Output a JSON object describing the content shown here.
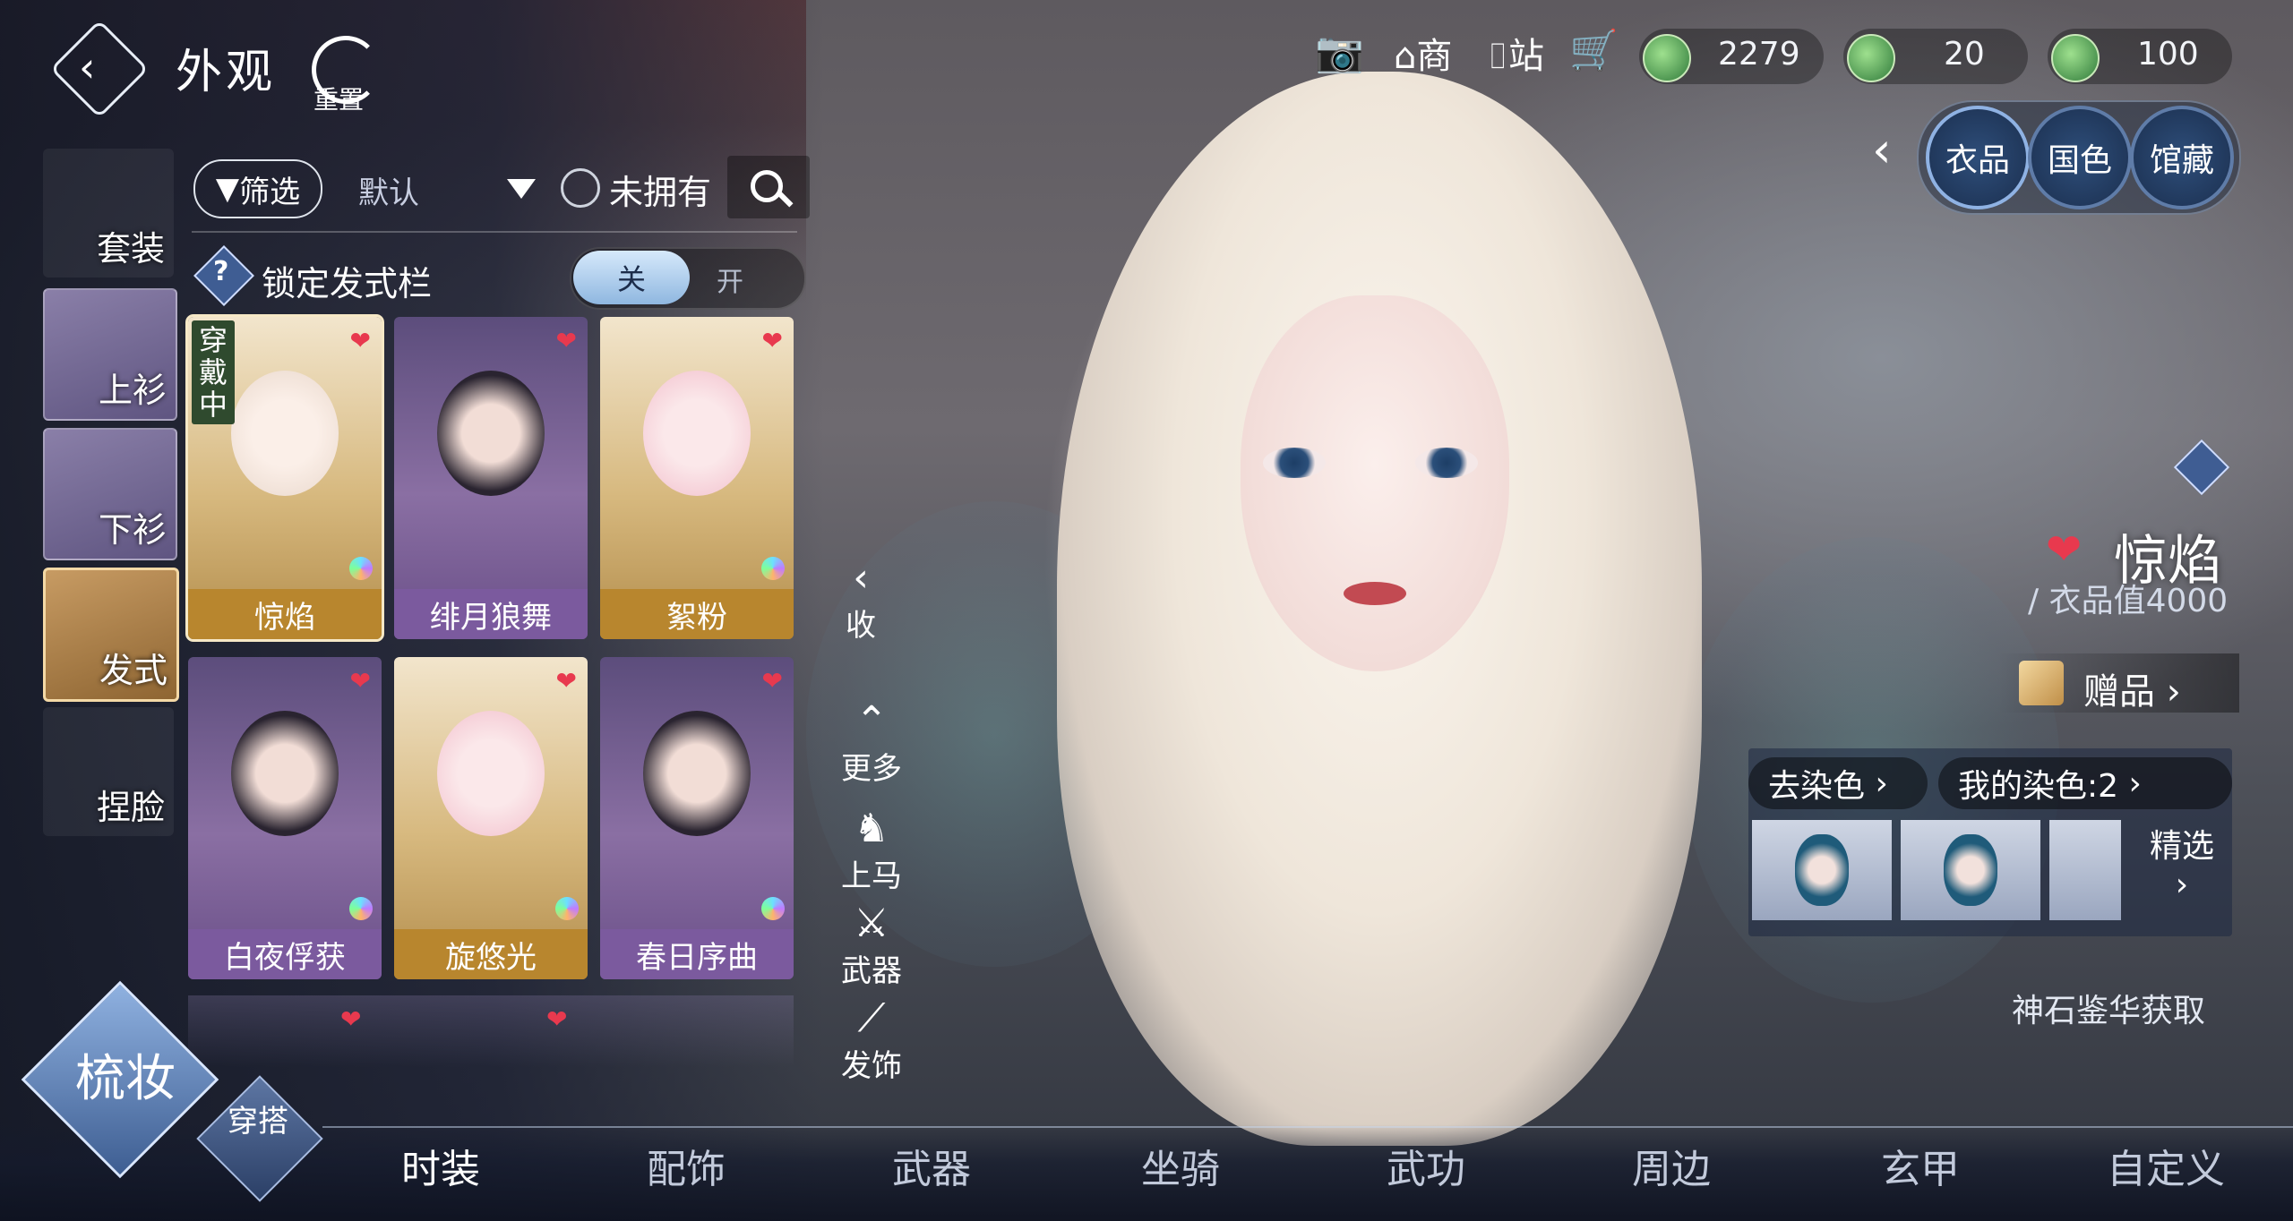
{
  "header": {
    "title": "外观",
    "reset_label": "重置"
  },
  "categories": [
    {
      "label": "套装"
    },
    {
      "label": "上衫"
    },
    {
      "label": "下衫"
    },
    {
      "label": "发式"
    },
    {
      "label": "捏脸"
    }
  ],
  "filter": {
    "filter_label": "筛选",
    "sort_label": "默认",
    "unowned_label": "未拥有"
  },
  "lock_row": {
    "label": "锁定发式栏",
    "help": "?",
    "toggle_on": "关",
    "toggle_off": "开"
  },
  "items": [
    {
      "name": "惊焰",
      "badge": "穿戴中",
      "style": "gold"
    },
    {
      "name": "绯月狼舞",
      "badge": "",
      "style": "purple"
    },
    {
      "name": "絮粉",
      "badge": "",
      "style": "gold"
    },
    {
      "name": "白夜俘获",
      "badge": "",
      "style": "purple"
    },
    {
      "name": "旋悠光",
      "badge": "",
      "style": "gold"
    },
    {
      "name": "春日序曲",
      "badge": "",
      "style": "purple"
    }
  ],
  "side_actions": [
    {
      "label": "收",
      "icon": "collapse-icon"
    },
    {
      "label": "更多",
      "icon": "more-icon"
    },
    {
      "label": "上马",
      "icon": "horse-icon"
    },
    {
      "label": "武器",
      "icon": "weapon-icon"
    },
    {
      "label": "发饰",
      "icon": "hair-accessory-icon"
    }
  ],
  "toolbar": {
    "shop_label": "商",
    "station_label": "站"
  },
  "currencies": [
    {
      "value": "2279"
    },
    {
      "value": "20"
    },
    {
      "value": "100"
    }
  ],
  "right_tabs": [
    {
      "label": "衣品"
    },
    {
      "label": "国色"
    },
    {
      "label": "馆藏"
    }
  ],
  "item_detail": {
    "name": "惊焰",
    "value_label": "/ 衣品值4000",
    "gift_label": "赠品",
    "dye_remove": "去染色",
    "dye_mine": "我的染色:2",
    "dye_featured": "精选",
    "source": "神石鉴华获取"
  },
  "bottom_nav": {
    "mode_primary": "梳妆",
    "mode_secondary": "穿搭",
    "tabs": [
      "时装",
      "配饰",
      "武器",
      "坐骑",
      "武功",
      "周边",
      "玄甲",
      "自定义"
    ],
    "active_index": 0
  },
  "colors": {
    "heart": "#e8394e",
    "gold_card": "#b8862e",
    "purple_card": "#7b5a9e",
    "accent_blue": "#8fb2e3"
  }
}
